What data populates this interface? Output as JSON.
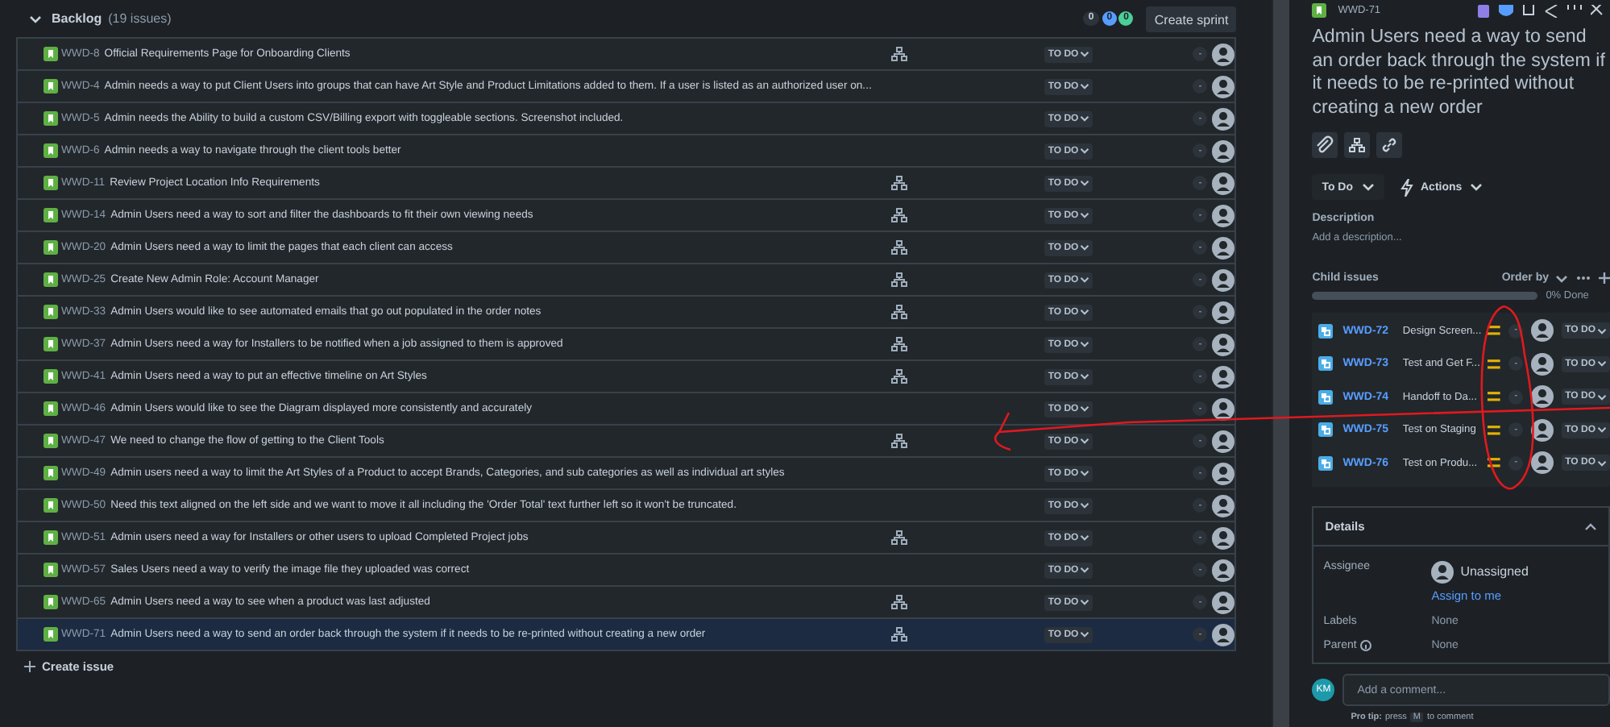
{
  "backlog": {
    "title": "Backlog",
    "count": "(19 issues)",
    "expanded": true,
    "counts": [
      {
        "value": "0",
        "kind": "todo"
      },
      {
        "value": "0",
        "kind": "progress"
      },
      {
        "value": "0",
        "kind": "done"
      }
    ],
    "create_sprint": "Create sprint",
    "rows": [
      {
        "key": "WWD-8",
        "summary": "Official Requirements Page for Onboarding Clients",
        "has_children": true,
        "status": "TO DO",
        "estimate": "-",
        "selected": false
      },
      {
        "key": "WWD-4",
        "summary": "Admin needs a way to put Client Users into groups that can have Art Style and Product Limitations added to them. If a user is listed as an authorized user on...",
        "has_children": false,
        "status": "TO DO",
        "estimate": "-",
        "selected": false
      },
      {
        "key": "WWD-5",
        "summary": "Admin needs the Ability to build a custom CSV/Billing export with toggleable sections. Screenshot included.",
        "has_children": false,
        "status": "TO DO",
        "estimate": "-",
        "selected": false
      },
      {
        "key": "WWD-6",
        "summary": "Admin needs a way to navigate through the client tools better",
        "has_children": false,
        "status": "TO DO",
        "estimate": "-",
        "selected": false
      },
      {
        "key": "WWD-11",
        "summary": "Review Project Location Info Requirements",
        "has_children": true,
        "status": "TO DO",
        "estimate": "-",
        "selected": false
      },
      {
        "key": "WWD-14",
        "summary": "Admin Users need a way to sort and filter the dashboards to fit their own viewing needs",
        "has_children": true,
        "status": "TO DO",
        "estimate": "-",
        "selected": false
      },
      {
        "key": "WWD-20",
        "summary": "Admin Users need a way to limit the pages that each client can access",
        "has_children": true,
        "status": "TO DO",
        "estimate": "-",
        "selected": false
      },
      {
        "key": "WWD-25",
        "summary": "Create New Admin Role: Account Manager",
        "has_children": true,
        "status": "TO DO",
        "estimate": "-",
        "selected": false
      },
      {
        "key": "WWD-33",
        "summary": "Admin Users would like to see automated emails that go out populated in the order notes",
        "has_children": true,
        "status": "TO DO",
        "estimate": "-",
        "selected": false
      },
      {
        "key": "WWD-37",
        "summary": "Admin Users need a way for Installers to be notified when a job assigned to them is approved",
        "has_children": true,
        "status": "TO DO",
        "estimate": "-",
        "selected": false
      },
      {
        "key": "WWD-41",
        "summary": "Admin Users need a way to put an effective timeline on Art Styles",
        "has_children": true,
        "status": "TO DO",
        "estimate": "-",
        "selected": false
      },
      {
        "key": "WWD-46",
        "summary": "Admin Users would like to see the Diagram displayed more consistently and accurately",
        "has_children": false,
        "status": "TO DO",
        "estimate": "-",
        "selected": false
      },
      {
        "key": "WWD-47",
        "summary": "We need to change the flow of getting to the Client Tools",
        "has_children": true,
        "status": "TO DO",
        "estimate": "-",
        "selected": false
      },
      {
        "key": "WWD-49",
        "summary": "Admin users need a way to limit the Art Styles of a Product to accept Brands, Categories, and sub categories as well as individual art styles",
        "has_children": false,
        "status": "TO DO",
        "estimate": "-",
        "selected": false
      },
      {
        "key": "WWD-50",
        "summary": "Need this text aligned on the left side and we want to move it all including the 'Order Total' text further left so it won't be truncated.",
        "has_children": false,
        "status": "TO DO",
        "estimate": "-",
        "selected": false
      },
      {
        "key": "WWD-51",
        "summary": "Admin users need a way for Installers or other users to upload Completed Project jobs",
        "has_children": true,
        "status": "TO DO",
        "estimate": "-",
        "selected": false
      },
      {
        "key": "WWD-57",
        "summary": "Sales Users need a way to verify the image file they uploaded was correct",
        "has_children": false,
        "status": "TO DO",
        "estimate": "-",
        "selected": false
      },
      {
        "key": "WWD-65",
        "summary": "Admin Users need a way to see when a product was last adjusted",
        "has_children": true,
        "status": "TO DO",
        "estimate": "-",
        "selected": false
      },
      {
        "key": "WWD-71",
        "summary": "Admin Users need a way to send an order back through the system if it needs to be re-printed without creating a new order",
        "has_children": true,
        "status": "TO DO",
        "estimate": "-",
        "selected": true
      }
    ],
    "create_issue": "Create issue"
  },
  "detail": {
    "key": "WWD-71",
    "title": "Admin Users need a way to send an order back through the system if it needs to be re-printed without creating a new order",
    "status": "To Do",
    "actions": "Actions",
    "description_label": "Description",
    "description_placeholder": "Add a description...",
    "child_issues_label": "Child issues",
    "order_by": "Order by",
    "progress": {
      "level": 0,
      "reading": "0% Done"
    },
    "children": [
      {
        "key": "WWD-72",
        "summary": "Design Screen...",
        "estimate": "-",
        "status": "TO DO"
      },
      {
        "key": "WWD-73",
        "summary": "Test and Get F...",
        "estimate": "-",
        "status": "TO DO"
      },
      {
        "key": "WWD-74",
        "summary": "Handoff to Da...",
        "estimate": "-",
        "status": "TO DO"
      },
      {
        "key": "WWD-75",
        "summary": "Test on Staging",
        "estimate": "-",
        "status": "TO DO"
      },
      {
        "key": "WWD-76",
        "summary": "Test on Produ...",
        "estimate": "-",
        "status": "TO DO"
      }
    ],
    "details": {
      "title": "Details",
      "expanded": true,
      "assignee_label": "Assignee",
      "assignee": "Unassigned",
      "assign_to_me": "Assign to me",
      "labels_label": "Labels",
      "labels": "None",
      "parent_label": "Parent",
      "parent": "None"
    },
    "comment": {
      "initials": "KM",
      "placeholder": "Add a comment...",
      "tip_label": "Pro tip:",
      "tip_before": "press",
      "tip_key": "M",
      "tip_after": "to comment"
    }
  }
}
